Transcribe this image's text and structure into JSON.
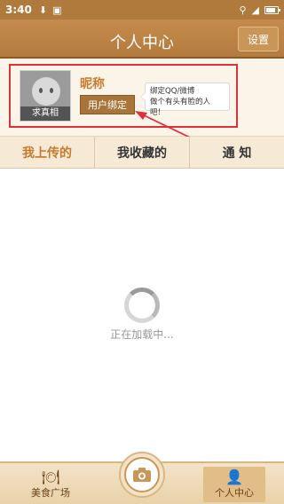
{
  "status_bar": {
    "time": "3:40"
  },
  "header": {
    "title": "个人中心",
    "settings_label": "设置"
  },
  "profile": {
    "avatar_caption": "求真相",
    "nickname": "昵称",
    "bind_button": "用户绑定",
    "tooltip_line1": "绑定QQ/微博",
    "tooltip_line2": "做个有头有脸的人吧！"
  },
  "tabs": [
    {
      "label": "我上传的"
    },
    {
      "label": "我收藏的"
    },
    {
      "label": "通 知"
    }
  ],
  "loading": {
    "text": "正在加载中..."
  },
  "bottom_nav": {
    "food_label": "美食广场",
    "me_label": "个人中心"
  },
  "colors": {
    "header": "#b37b3e",
    "active_tab": "#c67a2c",
    "highlight": "#e0313b"
  }
}
